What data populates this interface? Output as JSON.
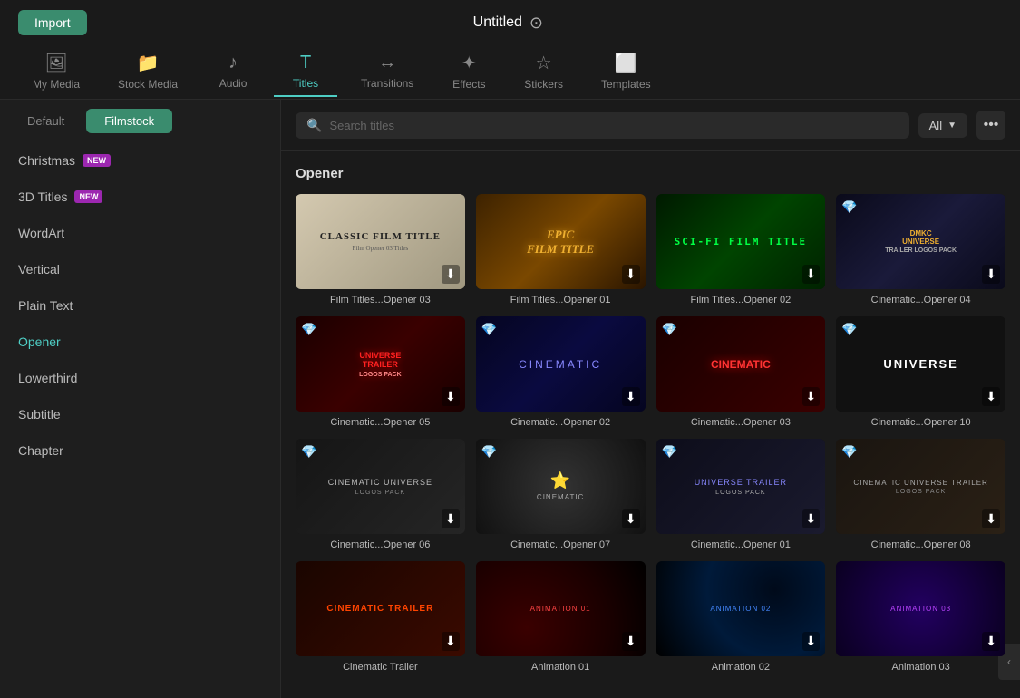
{
  "topBar": {
    "importLabel": "Import",
    "titleLabel": "Untitled",
    "titleIconLabel": "⊙"
  },
  "navTabs": [
    {
      "id": "my-media",
      "label": "My Media",
      "icon": "🖼",
      "active": false
    },
    {
      "id": "stock-media",
      "label": "Stock Media",
      "icon": "📁",
      "active": false
    },
    {
      "id": "audio",
      "label": "Audio",
      "icon": "♪",
      "active": false
    },
    {
      "id": "titles",
      "label": "Titles",
      "icon": "T",
      "active": true
    },
    {
      "id": "transitions",
      "label": "Transitions",
      "icon": "↔",
      "active": false
    },
    {
      "id": "effects",
      "label": "Effects",
      "icon": "✦",
      "active": false
    },
    {
      "id": "stickers",
      "label": "Stickers",
      "icon": "☆",
      "active": false
    },
    {
      "id": "templates",
      "label": "Templates",
      "icon": "⬜",
      "active": false
    }
  ],
  "sidebar": {
    "tabs": [
      {
        "id": "default",
        "label": "Default",
        "active": false
      },
      {
        "id": "filmstock",
        "label": "Filmstock",
        "active": true
      }
    ],
    "items": [
      {
        "id": "christmas",
        "label": "Christmas",
        "badge": "NEW",
        "active": false
      },
      {
        "id": "3d-titles",
        "label": "3D Titles",
        "badge": "NEW",
        "active": false
      },
      {
        "id": "wordart",
        "label": "WordArt",
        "badge": null,
        "active": false
      },
      {
        "id": "vertical",
        "label": "Vertical",
        "badge": null,
        "active": false
      },
      {
        "id": "plain-text",
        "label": "Plain Text",
        "badge": null,
        "active": false
      },
      {
        "id": "opener",
        "label": "Opener",
        "badge": null,
        "active": true
      },
      {
        "id": "lowerthird",
        "label": "Lowerthird",
        "badge": null,
        "active": false
      },
      {
        "id": "subtitle",
        "label": "Subtitle",
        "badge": null,
        "active": false
      },
      {
        "id": "chapter",
        "label": "Chapter",
        "badge": null,
        "active": false
      }
    ]
  },
  "searchBar": {
    "placeholder": "Search titles",
    "filterLabel": "All",
    "moreIcon": "•••"
  },
  "grid": {
    "sectionTitle": "Opener",
    "items": [
      {
        "id": "film-opener-03",
        "label": "Film Titles...Opener 03",
        "style": "classic-film",
        "hasBadge": false,
        "hasDownload": true
      },
      {
        "id": "film-opener-01",
        "label": "Film Titles...Opener 01",
        "style": "epic",
        "hasBadge": false,
        "hasDownload": true
      },
      {
        "id": "film-opener-02",
        "label": "Film Titles...Opener 02",
        "style": "scifi",
        "hasBadge": false,
        "hasDownload": true
      },
      {
        "id": "cinematic-opener-04",
        "label": "Cinematic...Opener 04",
        "style": "universe-dark",
        "hasBadge": true,
        "hasDownload": true
      },
      {
        "id": "cinematic-opener-05",
        "label": "Cinematic...Opener 05",
        "style": "trailer-red",
        "hasBadge": true,
        "hasDownload": true
      },
      {
        "id": "cinematic-opener-02",
        "label": "Cinematic...Opener 02",
        "style": "cinematic-blue",
        "hasBadge": true,
        "hasDownload": true
      },
      {
        "id": "cinematic-opener-03",
        "label": "Cinematic...Opener 03",
        "style": "cinematic-red-dark",
        "hasBadge": true,
        "hasDownload": true
      },
      {
        "id": "cinematic-opener-10",
        "label": "Cinematic...Opener 10",
        "style": "universe-black",
        "hasBadge": true,
        "hasDownload": true
      },
      {
        "id": "cinematic-opener-06",
        "label": "Cinematic...Opener 06",
        "style": "cin-uni",
        "hasBadge": true,
        "hasDownload": true
      },
      {
        "id": "cinematic-opener-07",
        "label": "Cinematic...Opener 07",
        "style": "cin-star",
        "hasBadge": true,
        "hasDownload": true
      },
      {
        "id": "cinematic-opener-01",
        "label": "Cinematic...Opener 01",
        "style": "uni-trailer",
        "hasBadge": true,
        "hasDownload": true
      },
      {
        "id": "cinematic-opener-08",
        "label": "Cinematic...Opener 08",
        "style": "logos-dark",
        "hasBadge": true,
        "hasDownload": true
      },
      {
        "id": "cinematic-trailer",
        "label": "Cinematic Trailer",
        "style": "cinematic-trailer",
        "hasBadge": false,
        "hasDownload": true
      },
      {
        "id": "animation-01",
        "label": "Animation 01",
        "style": "animation-red",
        "hasBadge": false,
        "hasDownload": true
      },
      {
        "id": "animation-02",
        "label": "Animation 02",
        "style": "animation-blue",
        "hasBadge": false,
        "hasDownload": true
      },
      {
        "id": "animation-03",
        "label": "Animation 03",
        "style": "animation-purple",
        "hasBadge": false,
        "hasDownload": true
      }
    ]
  }
}
